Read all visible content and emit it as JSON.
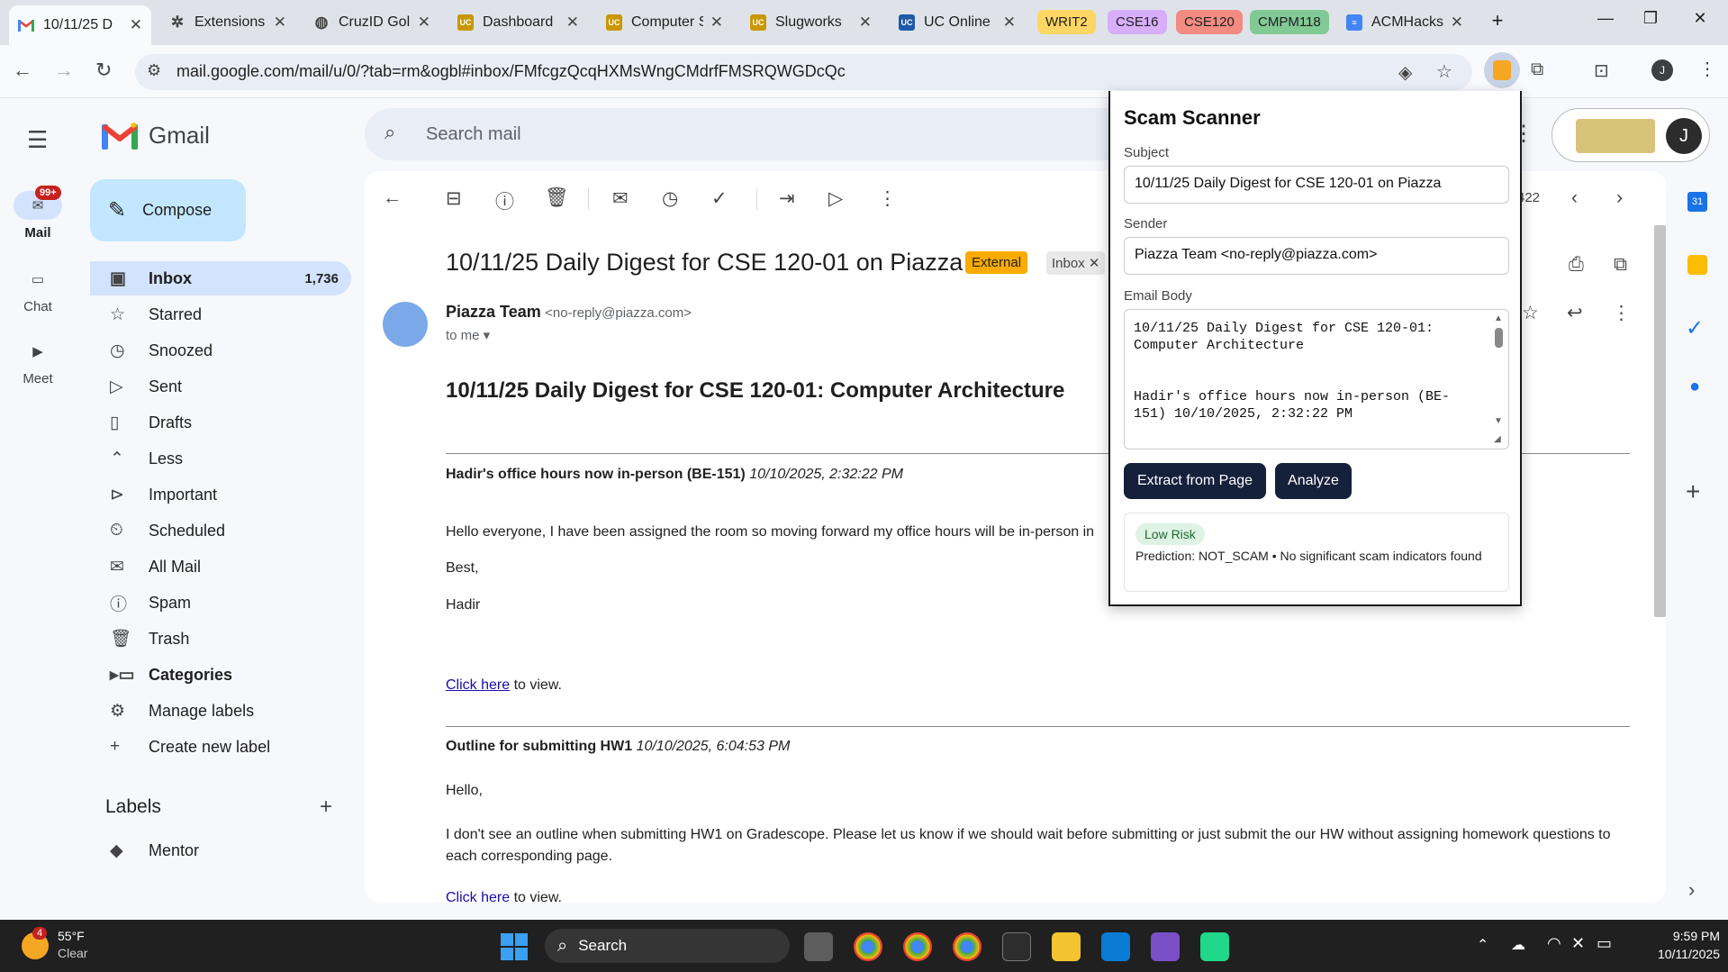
{
  "browser": {
    "tabs": [
      {
        "title": "10/11/25 D",
        "favicon": "gmail-icon",
        "active": true
      },
      {
        "title": "Extensions",
        "favicon": "puzzle-icon"
      },
      {
        "title": "CruzID Gol",
        "favicon": "globe-icon"
      },
      {
        "title": "Dashboard",
        "favicon": "ucsc-icon"
      },
      {
        "title": "Computer S",
        "favicon": "ucsc-icon"
      },
      {
        "title": "Slugworks",
        "favicon": "ucsc-icon"
      },
      {
        "title": "UC Online",
        "favicon": "uc-icon"
      }
    ],
    "tab_groups": [
      {
        "label": "WRIT2",
        "color": "#fdd663"
      },
      {
        "label": "CSE16",
        "color": "#d7aefb"
      },
      {
        "label": "CSE120",
        "color": "#f28b82"
      },
      {
        "label": "CMPM118",
        "color": "#81c995"
      }
    ],
    "extra_tab": {
      "title": "ACMHacks",
      "favicon": "docs-icon"
    },
    "url": "mail.google.com/mail/u/0/?tab=rm&ogbl#inbox/FMfcgzQcqHXMsWngCMdrfFMSRQWGDcQc",
    "profile_initial": "J"
  },
  "gmail": {
    "logo_text": "Gmail",
    "search_placeholder": "Search mail",
    "compose_label": "Compose",
    "rail": [
      {
        "label": "Mail",
        "badge": "99+"
      },
      {
        "label": "Chat"
      },
      {
        "label": "Meet"
      }
    ],
    "nav": [
      {
        "label": "Inbox",
        "count": "1,736",
        "icon": "inbox-icon",
        "active": true
      },
      {
        "label": "Starred",
        "icon": "star-icon"
      },
      {
        "label": "Snoozed",
        "icon": "clock-icon"
      },
      {
        "label": "Sent",
        "icon": "send-icon"
      },
      {
        "label": "Drafts",
        "icon": "draft-icon"
      },
      {
        "label": "Less",
        "icon": "chevron-up-icon"
      },
      {
        "label": "Important",
        "icon": "important-icon"
      },
      {
        "label": "Scheduled",
        "icon": "scheduled-icon"
      },
      {
        "label": "All Mail",
        "icon": "all-mail-icon"
      },
      {
        "label": "Spam",
        "icon": "spam-icon"
      },
      {
        "label": "Trash",
        "icon": "trash-icon"
      },
      {
        "label": "Categories",
        "icon": "label-icon"
      },
      {
        "label": "Manage labels",
        "icon": "gear-icon"
      },
      {
        "label": "Create new label",
        "icon": "plus-icon"
      }
    ],
    "labels_heading": "Labels",
    "labels": [
      {
        "label": "Mentor"
      }
    ],
    "pager": "422",
    "avatar_initial": "J",
    "email": {
      "subject": "10/11/25 Daily Digest for CSE 120-01 on Piazza",
      "tag_external": "External",
      "tag_inbox": "Inbox",
      "sender_name": "Piazza Team",
      "sender_email": "<no-reply@piazza.com>",
      "to": "to me",
      "heading": "10/11/25 Daily Digest for CSE 120-01: Computer Architecture",
      "posts": [
        {
          "title": "Hadir's office hours now in-person (BE-151)",
          "time": "10/10/2025, 2:32:22 PM",
          "lines": [
            "Hello everyone, I have been assigned the room so moving forward my office hours will be in-person in",
            "Best,",
            "Hadir"
          ],
          "link": "Click here",
          "link_suffix": " to view."
        },
        {
          "title": "Outline for submitting HW1",
          "time": "10/10/2025, 6:04:53 PM",
          "lines": [
            "Hello,",
            "I don't see an outline when submitting HW1 on Gradescope. Please let us know if we should wait before submitting or just submit the our HW without assigning homework questions to",
            "each corresponding page."
          ],
          "link": "Click here",
          "link_suffix": " to view."
        }
      ]
    }
  },
  "popup": {
    "title": "Scam Scanner",
    "subject_label": "Subject",
    "subject_value": "10/11/25 Daily Digest for CSE 120-01 on Piazza",
    "sender_label": "Sender",
    "sender_value": "Piazza Team <no-reply@piazza.com>",
    "body_label": "Email Body",
    "body_value": "10/11/25 Daily Digest for CSE 120-01:\nComputer Architecture\n\n\nHadir's office hours now in-person (BE-\n151) 10/10/2025, 2:32:22 PM",
    "extract_button": "Extract from Page",
    "analyze_button": "Analyze",
    "risk_badge": "Low Risk",
    "prediction": "Prediction: NOT_SCAM • No significant scam indicators found"
  },
  "taskbar": {
    "weather_temp": "55°F",
    "weather_desc": "Clear",
    "weather_badge": "4",
    "search_label": "Search",
    "time": "9:59 PM",
    "date": "10/11/2025"
  }
}
